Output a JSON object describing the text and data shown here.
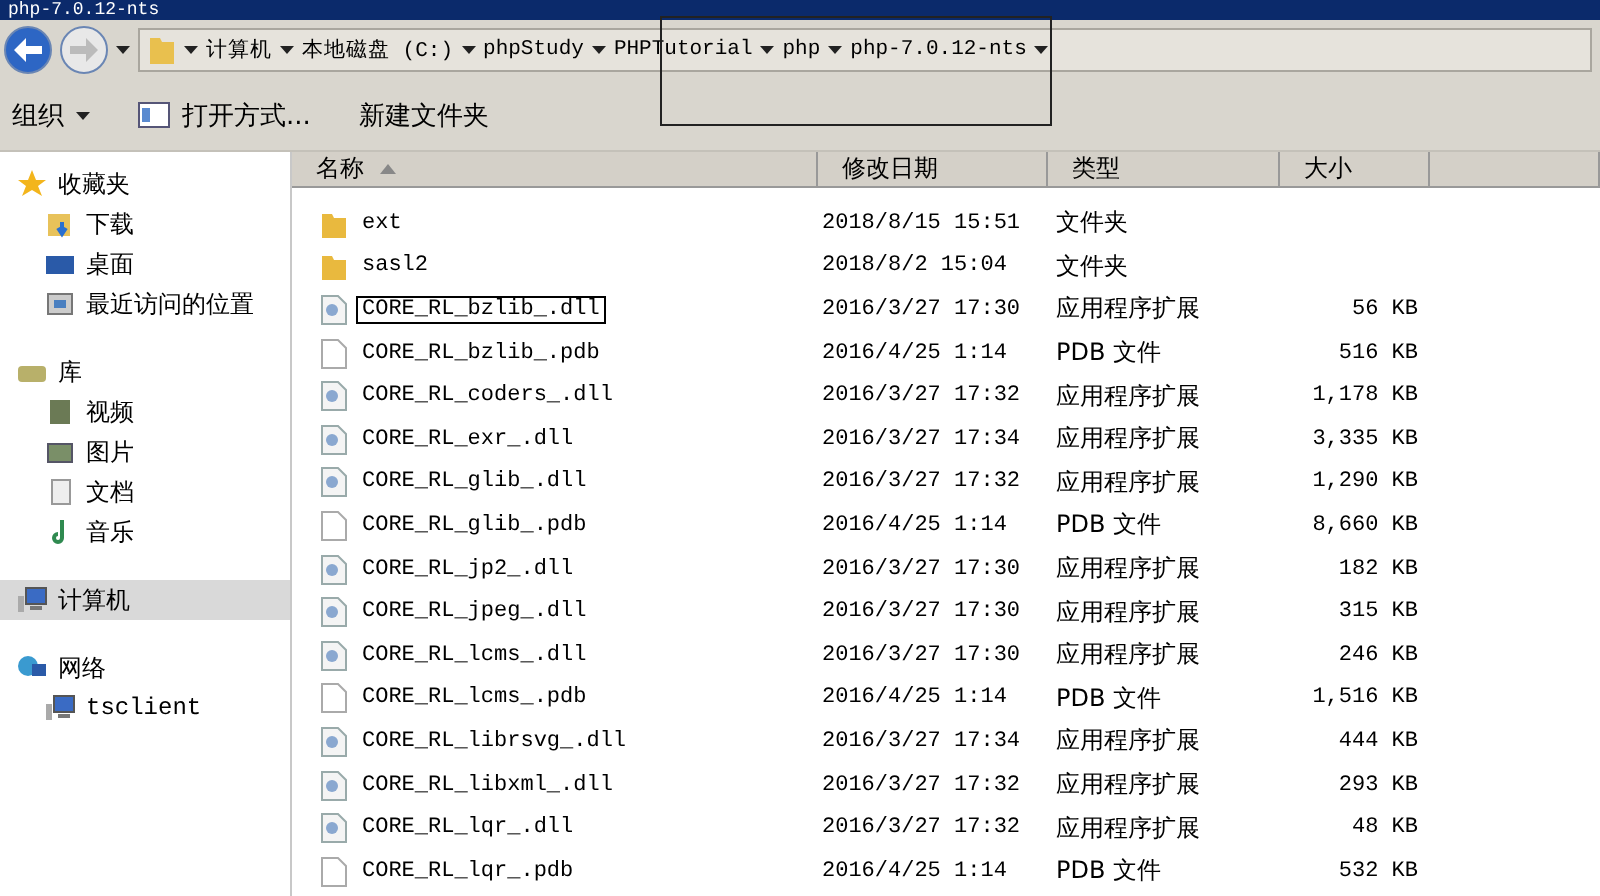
{
  "window": {
    "title": "php-7.0.12-nts"
  },
  "address_bar": {
    "segments": [
      "计算机",
      "本地磁盘 (C:)",
      "phpStudy",
      "PHPTutorial",
      "php",
      "php-7.0.12-nts"
    ]
  },
  "toolbar": [
    {
      "label": "组织",
      "kind": "menu"
    },
    {
      "label": "打开方式...",
      "kind": "open"
    },
    {
      "label": "新建文件夹",
      "kind": "plain"
    }
  ],
  "sidebar": {
    "groups": [
      {
        "label": "收藏夹",
        "kind": "star",
        "selected": false,
        "children": [
          {
            "label": "下载",
            "kind": "download",
            "selected": false
          },
          {
            "label": "桌面",
            "kind": "desktop",
            "selected": false
          },
          {
            "label": "最近访问的位置",
            "kind": "recent",
            "selected": false
          }
        ]
      },
      {
        "label": "库",
        "kind": "library",
        "selected": false,
        "children": [
          {
            "label": "视频",
            "kind": "video",
            "selected": false
          },
          {
            "label": "图片",
            "kind": "picture",
            "selected": false
          },
          {
            "label": "文档",
            "kind": "document",
            "selected": false
          },
          {
            "label": "音乐",
            "kind": "music",
            "selected": false
          }
        ]
      },
      {
        "label": "计算机",
        "kind": "computer",
        "selected": true
      },
      {
        "label": "网络",
        "kind": "network",
        "selected": false,
        "children": [
          {
            "label": "tsclient",
            "kind": "computer",
            "selected": false
          }
        ]
      }
    ]
  },
  "table": {
    "columns": [
      {
        "label": "名称",
        "sorted": true
      },
      {
        "label": "修改日期",
        "sorted": false
      },
      {
        "label": "类型",
        "sorted": false
      },
      {
        "label": "大小",
        "sorted": false
      }
    ],
    "rows": [
      {
        "name": "ext",
        "date": "2018/8/15 15:51",
        "type": "文件夹",
        "size": "",
        "kind": "folder",
        "selected": false
      },
      {
        "name": "sasl2",
        "date": "2018/8/2 15:04",
        "type": "文件夹",
        "size": "",
        "kind": "folder",
        "selected": false
      },
      {
        "name": "CORE_RL_bzlib_.dll",
        "date": "2016/3/27 17:30",
        "type": "应用程序扩展",
        "size": "56 KB",
        "kind": "dll",
        "selected": true
      },
      {
        "name": "CORE_RL_bzlib_.pdb",
        "date": "2016/4/25 1:14",
        "type": "PDB 文件",
        "size": "516 KB",
        "kind": "pdb",
        "selected": false
      },
      {
        "name": "CORE_RL_coders_.dll",
        "date": "2016/3/27 17:32",
        "type": "应用程序扩展",
        "size": "1,178 KB",
        "kind": "dll",
        "selected": false
      },
      {
        "name": "CORE_RL_exr_.dll",
        "date": "2016/3/27 17:34",
        "type": "应用程序扩展",
        "size": "3,335 KB",
        "kind": "dll",
        "selected": false
      },
      {
        "name": "CORE_RL_glib_.dll",
        "date": "2016/3/27 17:32",
        "type": "应用程序扩展",
        "size": "1,290 KB",
        "kind": "dll",
        "selected": false
      },
      {
        "name": "CORE_RL_glib_.pdb",
        "date": "2016/4/25 1:14",
        "type": "PDB 文件",
        "size": "8,660 KB",
        "kind": "pdb",
        "selected": false
      },
      {
        "name": "CORE_RL_jp2_.dll",
        "date": "2016/3/27 17:30",
        "type": "应用程序扩展",
        "size": "182 KB",
        "kind": "dll",
        "selected": false
      },
      {
        "name": "CORE_RL_jpeg_.dll",
        "date": "2016/3/27 17:30",
        "type": "应用程序扩展",
        "size": "315 KB",
        "kind": "dll",
        "selected": false
      },
      {
        "name": "CORE_RL_lcms_.dll",
        "date": "2016/3/27 17:30",
        "type": "应用程序扩展",
        "size": "246 KB",
        "kind": "dll",
        "selected": false
      },
      {
        "name": "CORE_RL_lcms_.pdb",
        "date": "2016/4/25 1:14",
        "type": "PDB 文件",
        "size": "1,516 KB",
        "kind": "pdb",
        "selected": false
      },
      {
        "name": "CORE_RL_librsvg_.dll",
        "date": "2016/3/27 17:34",
        "type": "应用程序扩展",
        "size": "444 KB",
        "kind": "dll",
        "selected": false
      },
      {
        "name": "CORE_RL_libxml_.dll",
        "date": "2016/3/27 17:32",
        "type": "应用程序扩展",
        "size": "293 KB",
        "kind": "dll",
        "selected": false
      },
      {
        "name": "CORE_RL_lqr_.dll",
        "date": "2016/3/27 17:32",
        "type": "应用程序扩展",
        "size": "48 KB",
        "kind": "dll",
        "selected": false
      },
      {
        "name": "CORE_RL_lqr_.pdb",
        "date": "2016/4/25 1:14",
        "type": "PDB 文件",
        "size": "532 KB",
        "kind": "pdb",
        "selected": false
      }
    ]
  }
}
